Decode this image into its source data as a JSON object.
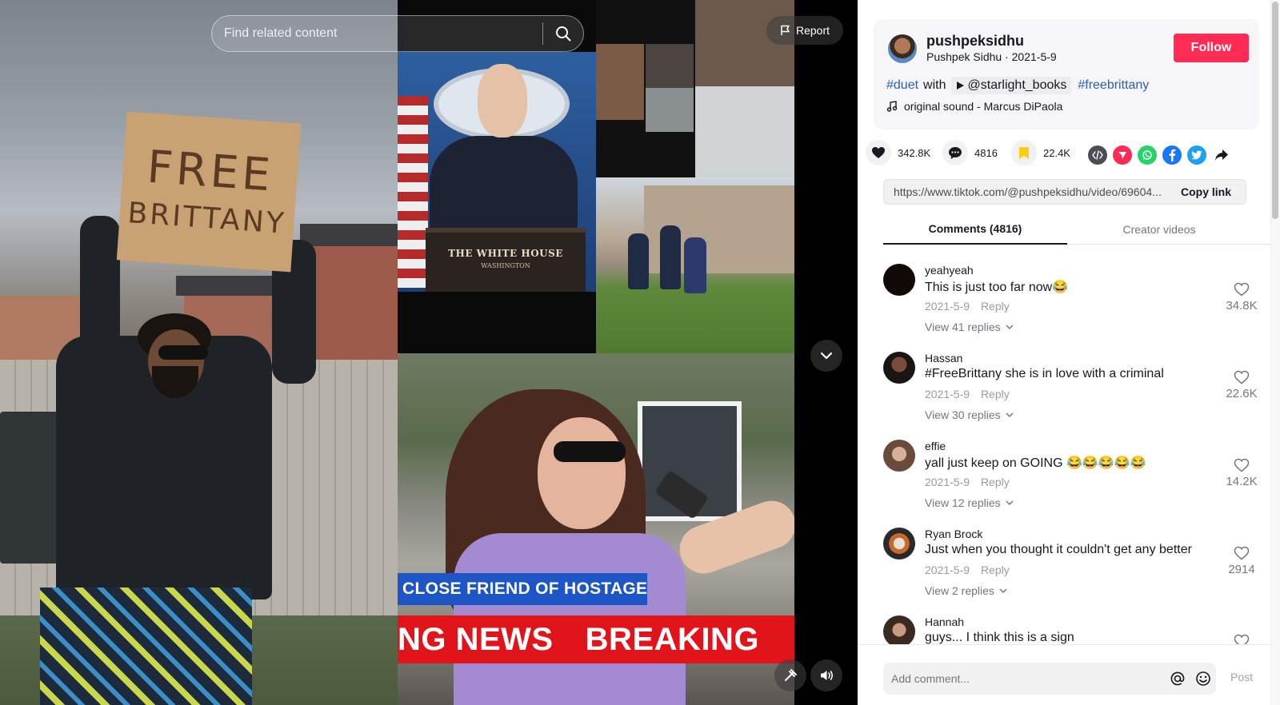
{
  "video": {
    "search_placeholder": "Find related content",
    "report_label": "Report",
    "sign_line1": "FREE",
    "sign_line2": "BRITTANY",
    "podium_text": "THE WHITE HOUSE",
    "podium_sub": "WASHINGTON",
    "chyron_top": "CLOSE FRIEND OF  HOSTAGE",
    "chyron_bottom_1": "NG NEWS",
    "chyron_bottom_2": "BREAKING"
  },
  "author": {
    "username": "pushpeksidhu",
    "display_name": "Pushpek Sidhu",
    "date": "2021-5-9",
    "follow_label": "Follow"
  },
  "description": {
    "tag1": "#duet",
    "with": "with",
    "duet_user": "@starlight_books",
    "tag2": "#freebrittany"
  },
  "music": "original sound - Marcus DiPaola",
  "actions": {
    "likes": "342.8K",
    "comments": "4816",
    "saves": "22.4K"
  },
  "share_icons": [
    "embed-icon",
    "tiktok-send-icon",
    "whatsapp-icon",
    "facebook-icon",
    "twitter-icon",
    "share-arrow-icon"
  ],
  "colors": {
    "accent": "#fe2c55",
    "hashtag": "#2b5db9",
    "save": "#face15"
  },
  "link": {
    "url": "https://www.tiktok.com/@pushpeksidhu/video/69604...",
    "copy_label": "Copy link"
  },
  "tabs": {
    "comments": "Comments (4816)",
    "creator": "Creator videos"
  },
  "comments": [
    {
      "user": "yeahyeah",
      "text": "This is just too far now😂",
      "date": "2021-5-9",
      "reply": "Reply",
      "view": "View 41 replies",
      "likes": "34.8K"
    },
    {
      "user": "Hassan",
      "text": "#FreeBrittany she is in love with a criminal",
      "date": "2021-5-9",
      "reply": "Reply",
      "view": "View 30 replies",
      "likes": "22.6K"
    },
    {
      "user": "effie",
      "text": "yall just keep on GOING 😂😂😂😂😂",
      "date": "2021-5-9",
      "reply": "Reply",
      "view": "View 12 replies",
      "likes": "14.2K"
    },
    {
      "user": "Ryan Brock",
      "text": "Just when you thought it couldn't get any better",
      "date": "2021-5-9",
      "reply": "Reply",
      "view": "View 2 replies",
      "likes": "2914"
    },
    {
      "user": "Hannah",
      "text": "guys... I think this is a sign",
      "date": "",
      "reply": "",
      "view": "",
      "likes": ""
    }
  ],
  "comment_bar": {
    "placeholder": "Add comment...",
    "post_label": "Post"
  }
}
